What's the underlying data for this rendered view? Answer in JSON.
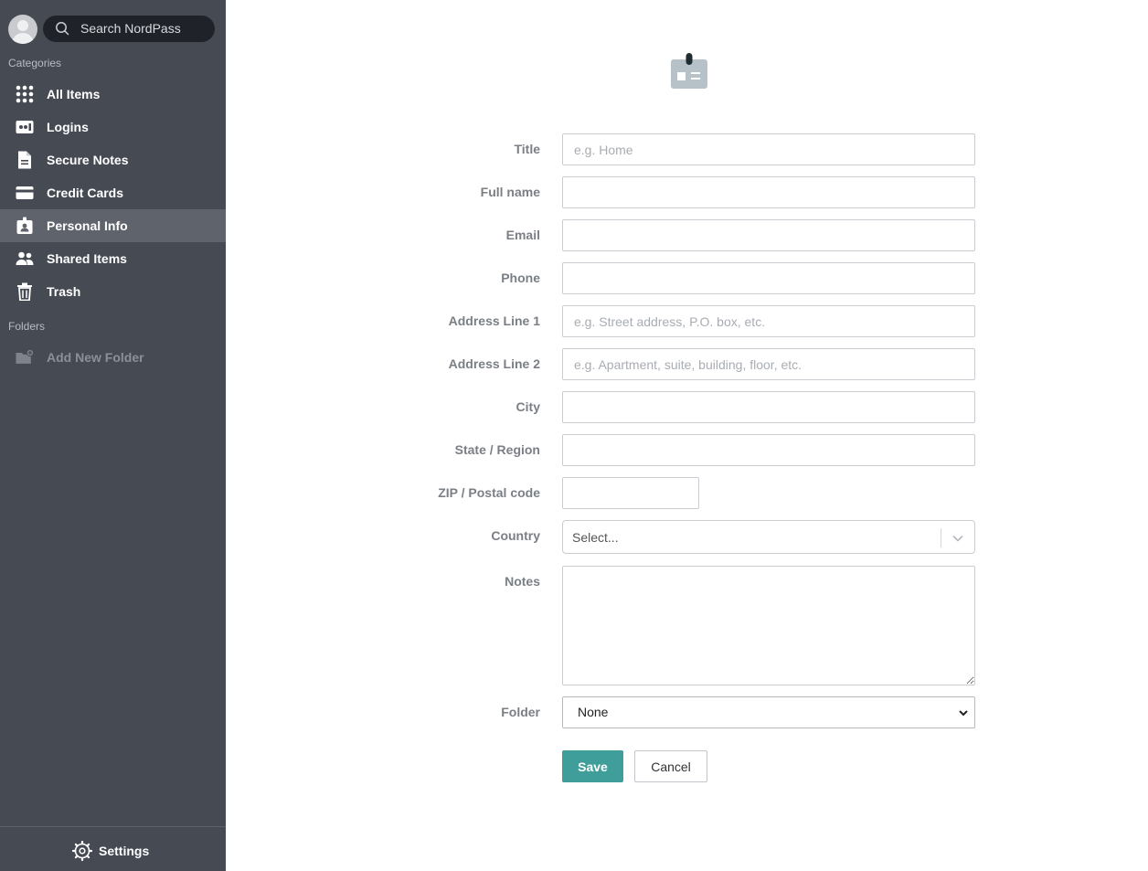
{
  "sidebar": {
    "search_placeholder": "Search NordPass",
    "categories_label": "Categories",
    "items": [
      {
        "label": "All Items",
        "icon": "grid-icon"
      },
      {
        "label": "Logins",
        "icon": "login-card-icon"
      },
      {
        "label": "Secure Notes",
        "icon": "note-icon"
      },
      {
        "label": "Credit Cards",
        "icon": "credit-card-icon"
      },
      {
        "label": "Personal Info",
        "icon": "id-badge-icon",
        "active": true
      },
      {
        "label": "Shared Items",
        "icon": "people-icon"
      },
      {
        "label": "Trash",
        "icon": "trash-icon"
      }
    ],
    "folders_label": "Folders",
    "add_folder_label": "Add New Folder",
    "settings_label": "Settings"
  },
  "form": {
    "header_icon": "id-badge-icon",
    "fields": {
      "title": {
        "label": "Title",
        "placeholder": "e.g. Home"
      },
      "full_name": {
        "label": "Full name",
        "placeholder": ""
      },
      "email": {
        "label": "Email",
        "placeholder": ""
      },
      "phone": {
        "label": "Phone",
        "placeholder": ""
      },
      "address1": {
        "label": "Address Line 1",
        "placeholder": "e.g. Street address, P.O. box, etc."
      },
      "address2": {
        "label": "Address Line 2",
        "placeholder": "e.g. Apartment, suite, building, floor, etc."
      },
      "city": {
        "label": "City",
        "placeholder": ""
      },
      "state": {
        "label": "State / Region",
        "placeholder": ""
      },
      "zip": {
        "label": "ZIP / Postal code",
        "placeholder": ""
      },
      "country": {
        "label": "Country",
        "value": "Select..."
      },
      "notes": {
        "label": "Notes",
        "placeholder": ""
      },
      "folder": {
        "label": "Folder",
        "value": "None"
      }
    },
    "save_label": "Save",
    "cancel_label": "Cancel"
  },
  "colors": {
    "sidebar_bg": "#454a53",
    "sidebar_active": "#5f646c",
    "accent": "#3f9e99"
  }
}
